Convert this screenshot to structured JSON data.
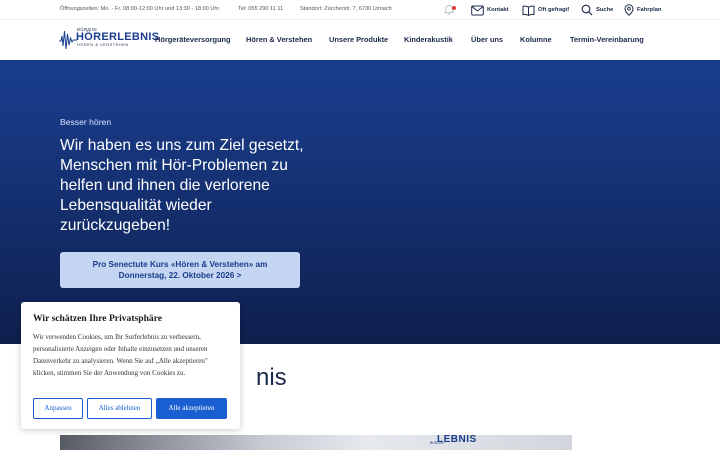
{
  "topbar": {
    "hours": "Öffnungszeiten: Mo. - Fr. 08:00-12:00 Uhr und 13:30 - 18:00 Uhr",
    "phone": "Tel: 055 290 11 11",
    "location": "Standort:  Zürcherstr. 7, 6730 Uznach",
    "contact_label": "Kontakt",
    "faq_label": "Oft gefragt!",
    "search_label": "Suche",
    "route_label": "Fahrplan"
  },
  "logo": {
    "top_word": "BÜRGIN",
    "brand": "HÖRERLEBNIS",
    "tagline": "HÖREN & VERSTEHEN"
  },
  "nav": {
    "items": [
      "Hörgeräteversorgung",
      "Hören & Verstehen",
      "Unsere Produkte",
      "Kinderakustik",
      "Über uns",
      "Kolumne",
      "Termin-Vereinbarung"
    ]
  },
  "hero": {
    "kicker": "Besser hören",
    "title": "Wir haben es uns zum Ziel gesetzt, Menschen mit Hör-Problemen zu helfen und ihnen die verlorene Lebensqualität wieder zurückzugeben!",
    "button_line1": "Pro Senectute Kurs «Hören & Verstehen» am",
    "button_line2": "Donnerstag, 22. Oktober 2026 >"
  },
  "section": {
    "heading_visible": "nis"
  },
  "photo": {
    "sign_text": "LEBNIS",
    "sign_small": "BÜRGIN"
  },
  "cookie": {
    "title": "Wir schätzen Ihre Privatsphäre",
    "body": "Wir verwenden Cookies, um Ihr Surferlebnis zu verbessern, personalisierte Anzeigen oder Inhalte einzusetzen und unseren Datenverkehr zu analysieren. Wenn Sie auf „Alle akzeptieren\" klicken, stimmen Sie der Anwendung von Cookies zu.",
    "customize_label": "Anpassen",
    "reject_label": "Alles ablehnen",
    "accept_label": "Alle akzeptieren"
  },
  "colors": {
    "brand_blue": "#1a3c8c",
    "hero_top": "#1a3e8f",
    "hero_bottom": "#0e1f4d",
    "cookie_accent": "#1a5fd1",
    "notification_dot": "#e53935"
  },
  "icons": {
    "bell": "bell-icon",
    "mail": "mail-icon",
    "book": "book-icon",
    "search": "search-icon",
    "location": "location-pin-icon",
    "wave": "sound-wave-icon"
  }
}
